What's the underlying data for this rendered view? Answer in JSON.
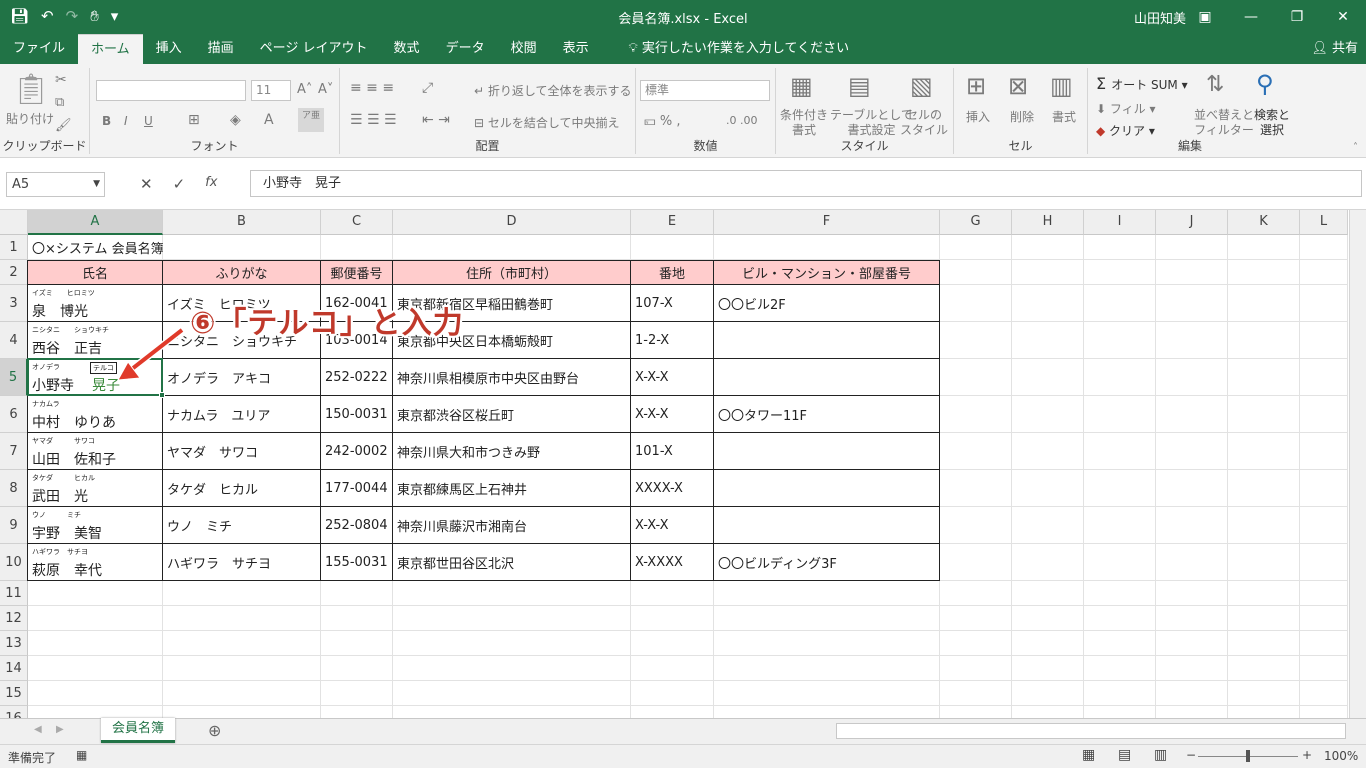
{
  "window": {
    "title": "会員名簿.xlsx  -  Excel",
    "user": "山田知美",
    "share": "共有"
  },
  "tabs": [
    "ファイル",
    "ホーム",
    "挿入",
    "描画",
    "ページ レイアウト",
    "数式",
    "データ",
    "校閲",
    "表示"
  ],
  "active_tab": "ホーム",
  "tell_me": "実行したい作業を入力してください",
  "ribbon": {
    "clipboard": {
      "paste": "貼り付け",
      "label": "クリップボード"
    },
    "font": {
      "size": "11",
      "label": "フォント",
      "bold": "B",
      "italic": "I",
      "underline": "U"
    },
    "alignment": {
      "wrap": "折り返して全体を表示する",
      "merge": "セルを結合して中央揃え",
      "label": "配置"
    },
    "number": {
      "format": "標準",
      "label": "数値"
    },
    "styles": {
      "cond": "条件付き\n書式",
      "table": "テーブルとして\n書式設定",
      "cell": "セルの\nスタイル",
      "label": "スタイル"
    },
    "cells": {
      "insert": "挿入",
      "delete": "削除",
      "format": "書式",
      "label": "セル"
    },
    "editing": {
      "autosum": "オート SUM",
      "fill": "フィル",
      "clear": "クリア",
      "sort": "並べ替えと\nフィルター",
      "find": "検索と\n選択",
      "label": "編集"
    }
  },
  "formula_bar": {
    "name_box": "A5",
    "content": "小野寺　晃子"
  },
  "columns": [
    "A",
    "B",
    "C",
    "D",
    "E",
    "F",
    "G",
    "H",
    "I",
    "J",
    "K",
    "L"
  ],
  "rows": [
    "1",
    "2",
    "3",
    "4",
    "5",
    "6",
    "7",
    "8",
    "9",
    "10",
    "11",
    "12",
    "13",
    "14",
    "15",
    "16"
  ],
  "sheet": {
    "title": "〇×システム 会員名簿",
    "headers": [
      "氏名",
      "ふりがな",
      "郵便番号",
      "住所（市町村）",
      "番地",
      "ビル・マンション・部屋番号"
    ],
    "records": [
      {
        "furigana_small": "イズミ　　ヒロミツ",
        "name": "泉　博光",
        "kana": "イズミ　ヒロミツ",
        "zip": "162-0041",
        "addr": "東京都新宿区早稲田鶴巻町",
        "banchi": "107-X",
        "bldg": "〇〇ビル2F"
      },
      {
        "furigana_small": "ニシタニ　　ショウキチ",
        "name": "西谷　正吉",
        "kana": "ニシタニ　ショウキチ",
        "zip": "103-0014",
        "addr": "東京都中央区日本橋蛎殻町",
        "banchi": "1-2-X",
        "bldg": ""
      },
      {
        "furigana_small": "オノデラ",
        "name": "小野寺　",
        "name_edit": "晃子",
        "edit_box": "テルコ",
        "kana": "オノデラ　アキコ",
        "zip": "252-0222",
        "addr": "神奈川県相模原市中央区由野台",
        "banchi": "X-X-X",
        "bldg": ""
      },
      {
        "furigana_small": "ナカムラ",
        "name": "中村　ゆりあ",
        "kana": "ナカムラ　ユリア",
        "zip": "150-0031",
        "addr": "東京都渋谷区桜丘町",
        "banchi": "X-X-X",
        "bldg": "〇〇タワー11F"
      },
      {
        "furigana_small": "ヤマダ　　　サワコ",
        "name": "山田　佐和子",
        "kana": "ヤマダ　サワコ",
        "zip": "242-0002",
        "addr": "神奈川県大和市つきみ野",
        "banchi": "101-X",
        "bldg": ""
      },
      {
        "furigana_small": "タケダ　　　ヒカル",
        "name": "武田　光",
        "kana": "タケダ　ヒカル",
        "zip": "177-0044",
        "addr": "東京都練馬区上石神井",
        "banchi": "XXXX-X",
        "bldg": ""
      },
      {
        "furigana_small": "ウノ　　　ミチ",
        "name": "宇野　美智",
        "kana": "ウノ　ミチ",
        "zip": "252-0804",
        "addr": "神奈川県藤沢市湘南台",
        "banchi": "X-X-X",
        "bldg": ""
      },
      {
        "furigana_small": "ハギワラ　サチヨ",
        "name": "萩原　幸代",
        "kana": "ハギワラ　サチヨ",
        "zip": "155-0031",
        "addr": "東京都世田谷区北沢",
        "banchi": "X-XXXX",
        "bldg": "〇〇ビルディング3F"
      }
    ]
  },
  "sheet_tab": "会員名簿",
  "status": {
    "ready": "準備完了",
    "zoom": "100%"
  },
  "annotation": "⑥「テルコ」と入力",
  "colors": {
    "excel_green": "#217346",
    "header_fill": "#ffcccc",
    "annotation_red": "#c0392b",
    "edit_green": "#3a8a3a"
  }
}
